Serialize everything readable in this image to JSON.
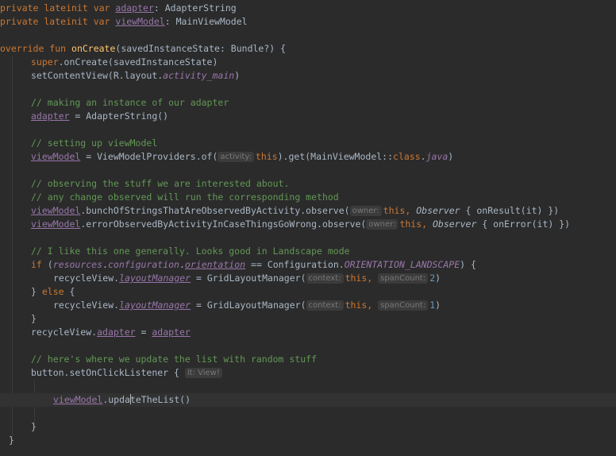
{
  "code": {
    "l1": {
      "kw": "private lateinit var ",
      "var": "adapter",
      "type": ": AdapterString"
    },
    "l2": {
      "kw": "private lateinit var ",
      "var": "viewModel",
      "type": ": MainViewModel"
    },
    "l4": {
      "kw": "override fun ",
      "fn": "onCreate",
      "rest": "(savedInstanceState: Bundle?) {"
    },
    "l5": {
      "kw": "super",
      "rest": ".onCreate(savedInstanceState)"
    },
    "l6": {
      "pre": "setContentView(R.layout.",
      "prop": "activity_main",
      "post": ")"
    },
    "l8": {
      "comment": "// making an instance of our adapter"
    },
    "l9": {
      "var": "adapter",
      "rest": " = AdapterString()"
    },
    "l11": {
      "comment": "// setting up viewModel"
    },
    "l12": {
      "var": "viewModel",
      "pre": " = ViewModelProviders.of(",
      "hint": "activity:",
      "kw": "this",
      "mid": ").get(MainViewModel::",
      "kw2": "class",
      "dot": ".",
      "prop": "java",
      "post": ")"
    },
    "l14": {
      "comment": "// observing the stuff we are interested about."
    },
    "l15": {
      "comment": "// any change observed will run the corresponding method"
    },
    "l16": {
      "var": "viewModel",
      "pre": ".bunchOfStringsThatAreObservedByActivity.observe(",
      "hint": "owner:",
      "kw": "this, ",
      "it": "Observer",
      "post": " { onResult(it) })"
    },
    "l17": {
      "var": "viewModel",
      "pre": ".errorObservedByActivityInCaseThingsGoWrong.observe(",
      "hint": "owner:",
      "kw": "this, ",
      "it": "Observer",
      "post": " { onError(it) })"
    },
    "l19": {
      "comment": "// I like this one generally. Looks good in Landscape mode"
    },
    "l20": {
      "kw": "if",
      "open": " (",
      "p1": "resources",
      "dot1": ".",
      "p2": "configuration",
      "dot2": ".",
      "p3": "orientation",
      "mid": " == Configuration.",
      "p4": "ORIENTATION_LANDSCAPE",
      "post": ") {"
    },
    "l21": {
      "pre": "recycleView.",
      "prop": "layoutManager",
      "mid": " = GridLayoutManager(",
      "hint1": "context:",
      "kw": "this, ",
      "hint2": "spanCount:",
      "num": "2",
      "post": ")"
    },
    "l22": {
      "pre": "} ",
      "kw": "else",
      "post": " {"
    },
    "l23": {
      "pre": "recycleView.",
      "prop": "layoutManager",
      "mid": " = GridLayoutManager(",
      "hint1": "context:",
      "kw": "this, ",
      "hint2": "spanCount:",
      "num": "1",
      "post": ")"
    },
    "l24": {
      "text": "}"
    },
    "l25": {
      "pre": "recycleView.",
      "prop": "adapter",
      "mid": " = ",
      "var": "adapter"
    },
    "l27": {
      "comment": "// here's where we update the list with random stuff"
    },
    "l28": {
      "pre": "button.setOnClickListener { ",
      "hint": "it: View!"
    },
    "l30": {
      "var": "viewModel",
      "pre": ".upda",
      "post": "teTheList()"
    },
    "l32": {
      "text": "}"
    },
    "l33": {
      "text": "}"
    }
  }
}
